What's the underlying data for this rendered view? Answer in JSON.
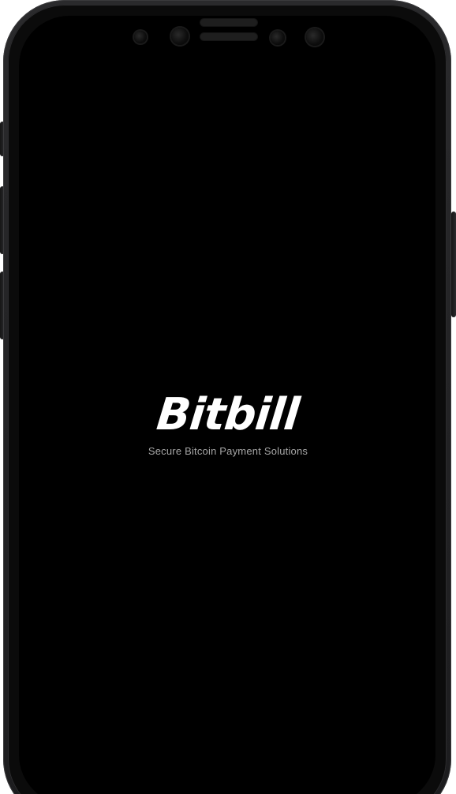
{
  "splash": {
    "brand": "Bitbill",
    "tagline": "Secure Bitcoin Payment Solutions"
  },
  "colors": {
    "screen_background": "#000000",
    "brand_text": "#ffffff",
    "tagline_text": "#a6a6a6",
    "device_frame": "#1c1c1e"
  }
}
